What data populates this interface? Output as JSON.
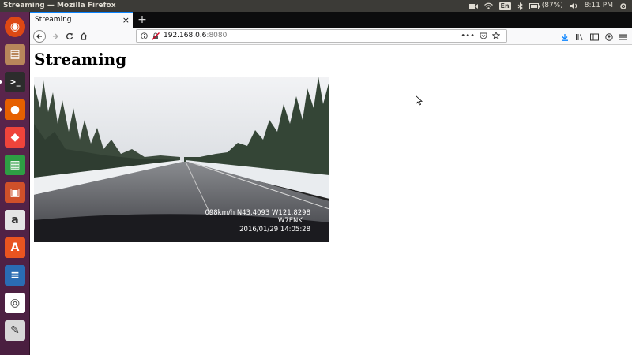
{
  "window": {
    "title": "Streaming — Mozilla Firefox"
  },
  "top_panel": {
    "keyboard_layout": "En",
    "battery": "(87%)",
    "time": "8:11 PM"
  },
  "launcher": {
    "apps": [
      {
        "name": "ubuntu-dash-icon",
        "color": "#dd4814"
      },
      {
        "name": "files-icon",
        "color": "#b8865b"
      },
      {
        "name": "terminal-icon",
        "color": "#2c2c2c"
      },
      {
        "name": "firefox-icon",
        "color": "#e66000"
      },
      {
        "name": "anydesk-icon",
        "color": "#ef443b"
      },
      {
        "name": "libreoffice-calc-icon",
        "color": "#2e9e44"
      },
      {
        "name": "libreoffice-impress-icon",
        "color": "#d0502a"
      },
      {
        "name": "amazon-icon",
        "color": "#e5e5e5"
      },
      {
        "name": "software-center-icon",
        "color": "#e95420"
      },
      {
        "name": "libreoffice-writer-icon",
        "color": "#2a6cb3"
      },
      {
        "name": "chrome-icon",
        "color": "#ffffff"
      },
      {
        "name": "text-editor-icon",
        "color": "#d8d8d8"
      }
    ]
  },
  "browser": {
    "tab_title": "Streaming",
    "url_host": "192.168.0.6",
    "url_port": ":8080"
  },
  "page": {
    "heading": "Streaming",
    "video_overlay": {
      "line1": "098km/h N43.4093 W121.8298",
      "line2": "W7ENK",
      "line3": "2016/01/29 14:05:28"
    }
  },
  "colors": {
    "panel_bg": "#3c3b37",
    "launcher_bg": "#5e2750",
    "tab_accent": "#0a84ff"
  }
}
